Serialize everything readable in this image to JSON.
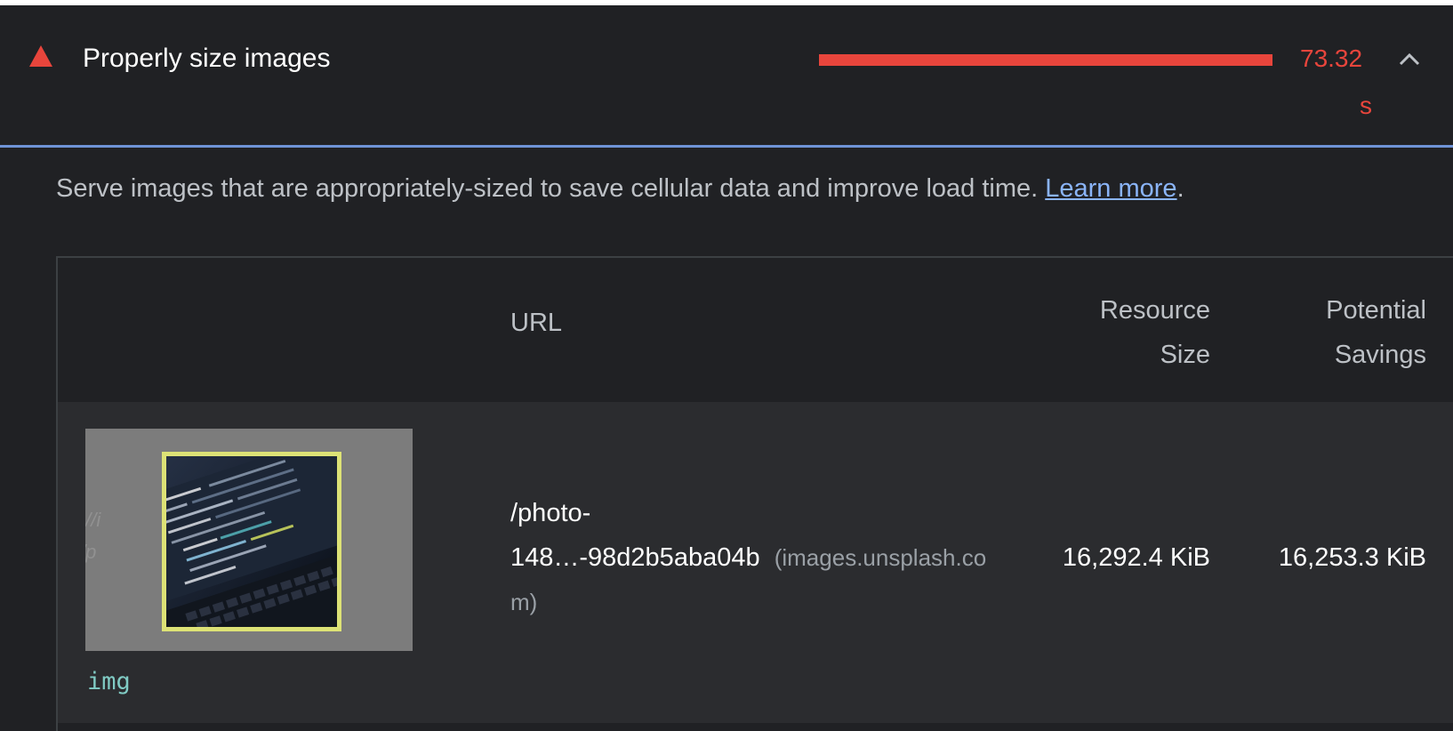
{
  "audit": {
    "title": "Properly size images",
    "savings_value": "73.32",
    "savings_unit": "s",
    "savings_fraction": 1.0,
    "status_color": "#e8453c"
  },
  "description": {
    "text": "Serve images that are appropriately-sized to save cellular data and improve load time. ",
    "link_text": "Learn more",
    "suffix": "."
  },
  "table": {
    "headers": {
      "url": "URL",
      "resource_size_line1": "Resource",
      "resource_size_line2": "Size",
      "potential_savings_line1": "Potential",
      "potential_savings_line2": "Savings"
    },
    "rows": [
      {
        "node_label": "img",
        "thumb_ghost_line1": "://i",
        "thumb_ghost_line2": "/p",
        "url_line1": "/photo-",
        "url_line2": "148…-98d2b5aba04b",
        "host_part1": "(images.unsplash.co",
        "host_part2": "m)",
        "resource_size": "16,292.4 KiB",
        "potential_savings": "16,253.3 KiB"
      }
    ]
  },
  "icons": {
    "status": "warning-triangle-icon",
    "collapse": "chevron-up-icon"
  },
  "colors": {
    "accent_border": "#6e93d6",
    "link": "#8ab4f8",
    "node": "#80cbc4",
    "thumbnail_highlight": "#dde276"
  }
}
